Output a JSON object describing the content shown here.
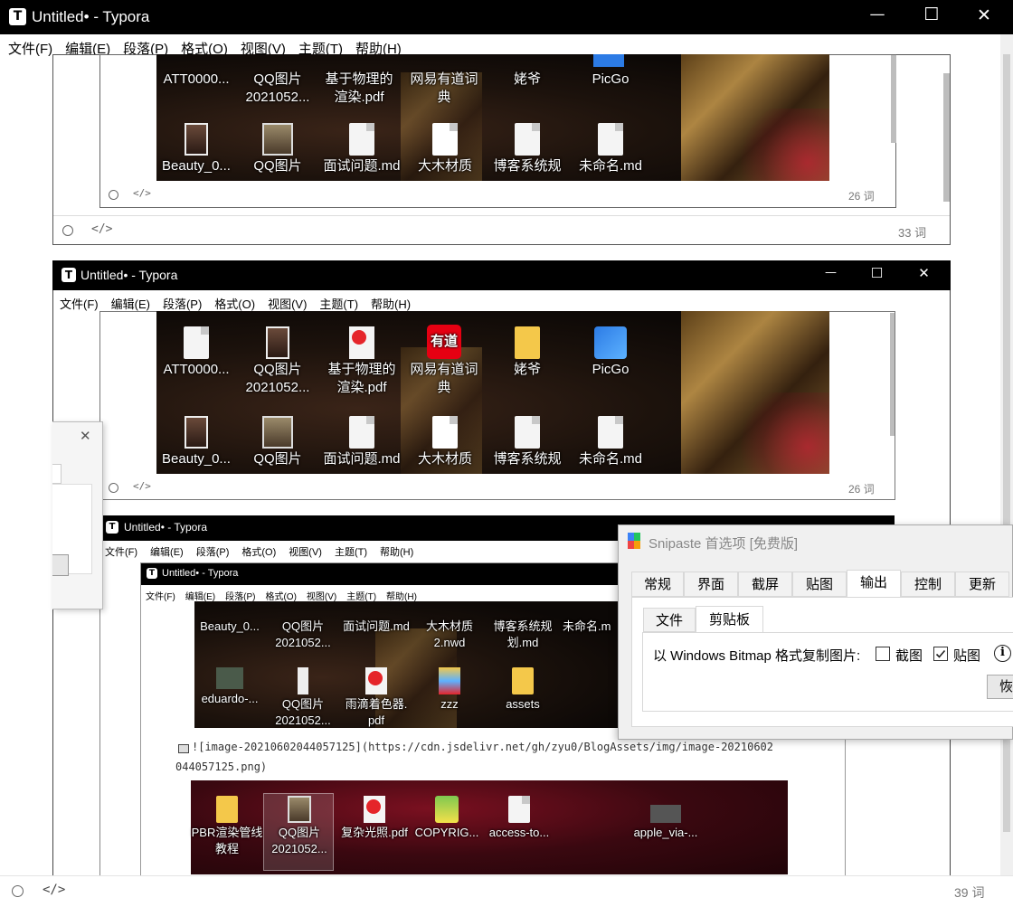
{
  "window_title": "Untitled• - Typora",
  "menu": [
    "文件(F)",
    "编辑(E)",
    "段落(P)",
    "格式(O)",
    "视图(V)",
    "主题(T)",
    "帮助(H)"
  ],
  "win_controls": {
    "minimize": "—",
    "maximize": "☐",
    "close": "✕"
  },
  "status": {
    "code_icon": "</>"
  },
  "wordcounts": {
    "inner_top": "26 词",
    "outer_top": "33 词",
    "window2": "26 词",
    "bottom": "39 词"
  },
  "desktop_row1": [
    {
      "label": "ATT0000...",
      "icon": "file-icon"
    },
    {
      "label": "QQ图片\n2021052...",
      "icon": "image-icon"
    },
    {
      "label": "基于物理的\n渲染.pdf",
      "icon": "pdf-icon"
    },
    {
      "label": "网易有道词\n典",
      "icon": "youdao-icon"
    },
    {
      "label": "姥爷",
      "icon": "folder-icon"
    },
    {
      "label": "PicGo",
      "icon": "picgo-icon"
    }
  ],
  "desktop_row2": [
    {
      "label": "Beauty_0...",
      "icon": "image-icon"
    },
    {
      "label": "QQ图片",
      "icon": "qq-image-icon"
    },
    {
      "label": "面试问题.md",
      "icon": "file-icon"
    },
    {
      "label": "大木材质",
      "icon": "file-icon"
    },
    {
      "label": "博客系统规",
      "icon": "file-icon"
    },
    {
      "label": "未命名.md",
      "icon": "file-icon"
    }
  ],
  "inner_desktop_row1": [
    {
      "label": "Beauty_0..."
    },
    {
      "label": "QQ图片\n2021052..."
    },
    {
      "label": "面试问题.md"
    },
    {
      "label": "大木材质\n2.nwd"
    },
    {
      "label": "博客系统规\n划.md"
    },
    {
      "label": "未命名.m"
    }
  ],
  "inner_desktop_row2": [
    {
      "label": "eduardo-..."
    },
    {
      "label": "QQ图片\n2021052..."
    },
    {
      "label": "雨滴着色器.\npdf"
    },
    {
      "label": "zzz"
    },
    {
      "label": "assets"
    }
  ],
  "markdown_source_line1": "![image-20210602044057125](https://cdn.jsdelivr.net/gh/zyu0/BlogAssets/img/image-20210602",
  "markdown_source_line2": "044057125.png)",
  "bottom_desktop": [
    {
      "label": "PBR渲染管线\n教程"
    },
    {
      "label": "QQ图片\n2021052..."
    },
    {
      "label": "复杂光照.pdf"
    },
    {
      "label": "COPYRIG..."
    },
    {
      "label": "access-to..."
    },
    {
      "label": "apple_via-..."
    }
  ],
  "snipaste": {
    "title": "Snipaste 首选项 [免费版]",
    "tabs": [
      "常规",
      "界面",
      "截屏",
      "贴图",
      "输出",
      "控制",
      "更新"
    ],
    "active_tab": "输出",
    "subtabs": [
      "文件",
      "剪贴板"
    ],
    "active_subtab": "剪贴板",
    "option_label": "以 Windows Bitmap 格式复制图片:",
    "checkbox_screenshot": {
      "label": "截图",
      "checked": false
    },
    "checkbox_paste": {
      "label": "贴图",
      "checked": true
    },
    "info_icon": "i",
    "restore_button": "恢"
  },
  "small_dialog": {
    "close": "✕"
  }
}
